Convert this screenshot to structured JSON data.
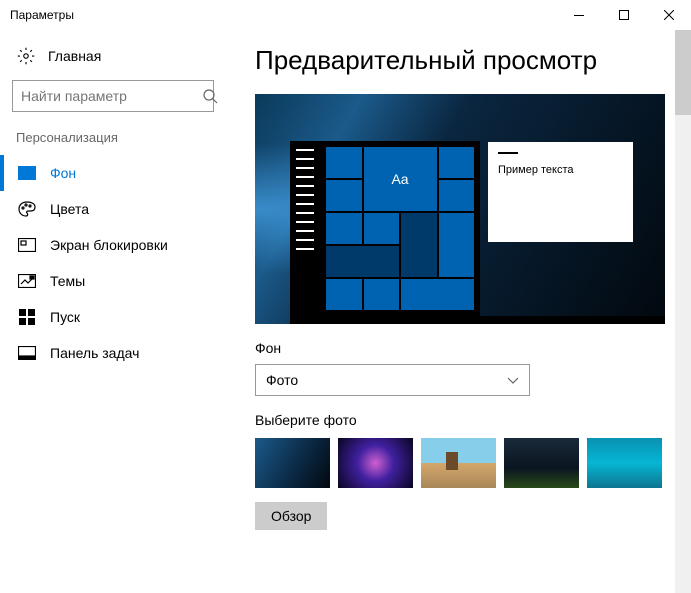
{
  "window": {
    "title": "Параметры"
  },
  "sidebar": {
    "home": "Главная",
    "search_placeholder": "Найти параметр",
    "category": "Персонализация",
    "items": [
      {
        "label": "Фон"
      },
      {
        "label": "Цвета"
      },
      {
        "label": "Экран блокировки"
      },
      {
        "label": "Темы"
      },
      {
        "label": "Пуск"
      },
      {
        "label": "Панель задач"
      }
    ]
  },
  "main": {
    "heading": "Предварительный просмотр",
    "sample_text": "Пример текста",
    "tile_text": "Aa",
    "bg_label": "Фон",
    "bg_selected": "Фото",
    "choose_label": "Выберите фото",
    "browse": "Обзор"
  }
}
